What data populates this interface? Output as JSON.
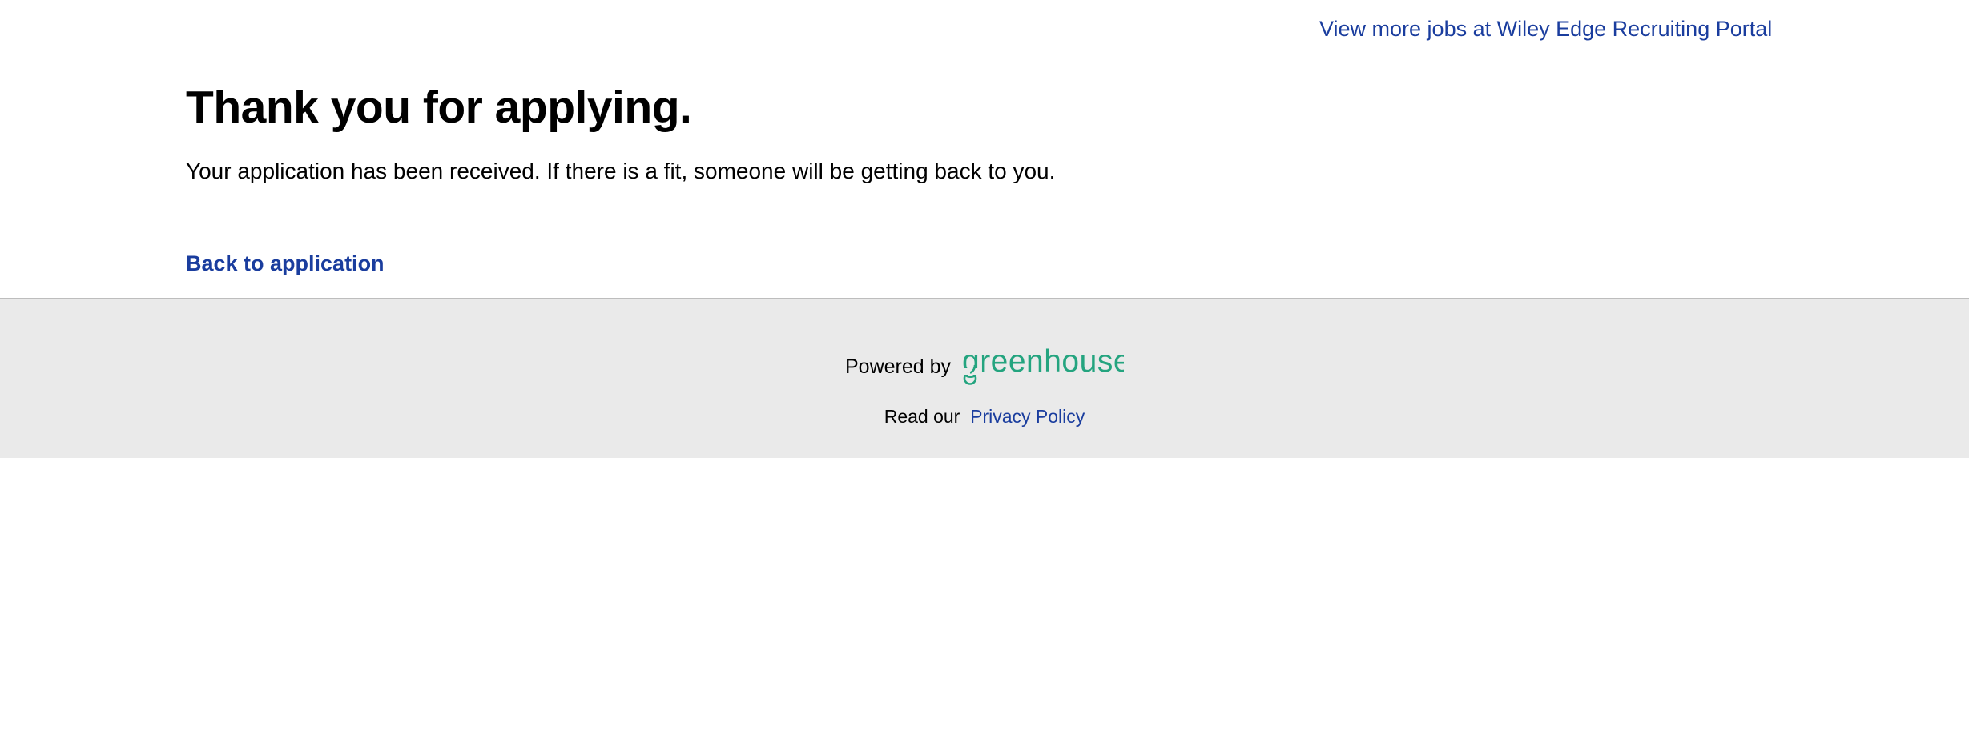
{
  "header": {
    "more_jobs_link": "View more jobs at Wiley Edge Recruiting Portal"
  },
  "main": {
    "title": "Thank you for applying.",
    "message": "Your application has been received. If there is a fit, someone will be getting back to you.",
    "back_link": "Back to application"
  },
  "footer": {
    "powered_by": "Powered by",
    "logo_text": "greenhouse",
    "logo_icon": "greenhouse-logo",
    "privacy_prefix": "Read our",
    "privacy_link": "Privacy Policy"
  },
  "colors": {
    "link": "#1a3d9e",
    "footer_bg": "#eaeaea",
    "greenhouse_green": "#24a47f"
  }
}
